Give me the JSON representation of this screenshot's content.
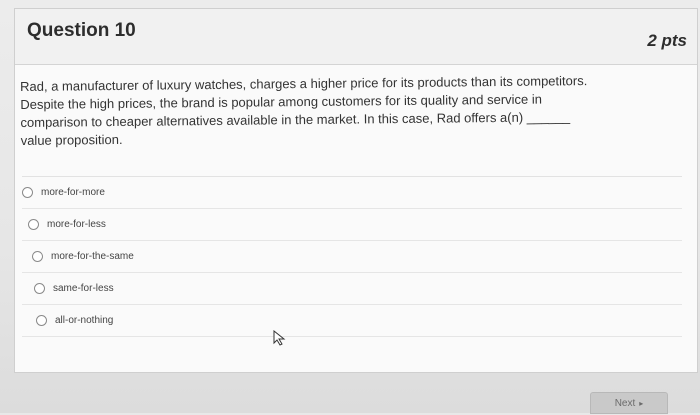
{
  "question": {
    "title": "Question 10",
    "points": "2 pts",
    "text_lines": [
      "Rad, a manufacturer of luxury watches, charges a higher price for its products than its competitors.",
      "Despite the high prices, the brand is popular among customers for its quality and service in",
      "comparison to cheaper alternatives available in the market. In this case, Rad offers a(n) ______",
      "value proposition."
    ]
  },
  "answers": [
    {
      "label": "more-for-more"
    },
    {
      "label": "more-for-less"
    },
    {
      "label": "more-for-the-same"
    },
    {
      "label": "same-for-less"
    },
    {
      "label": "all-or-nothing"
    }
  ],
  "footer": {
    "next_label": "Next",
    "next_arrow": "▸"
  },
  "icons": {
    "cursor": "mouse-pointer-icon",
    "radio": "radio-button-icon"
  },
  "colors": {
    "header_bg": "#f1f1f1",
    "card_bg": "#fafafa",
    "text": "#333333"
  }
}
